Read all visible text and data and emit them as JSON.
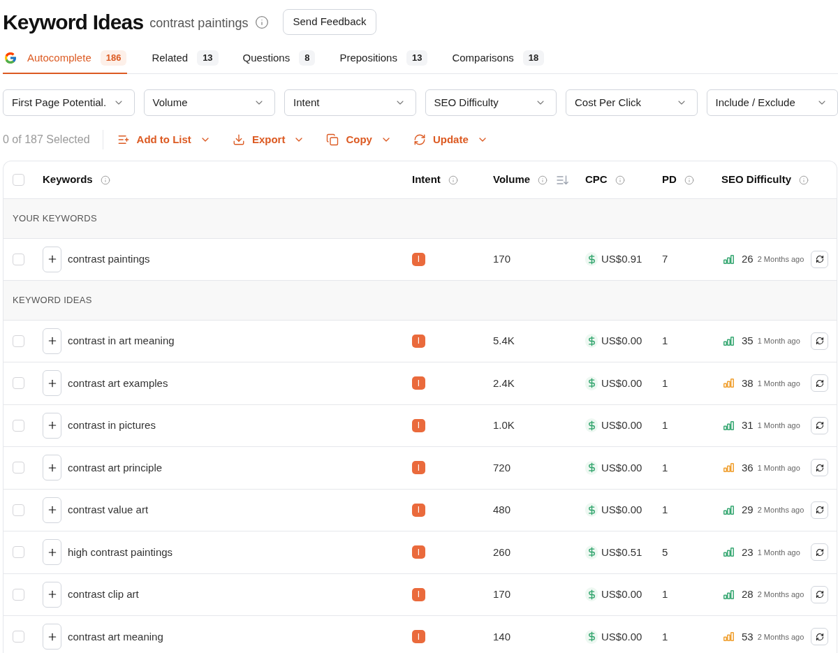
{
  "header": {
    "title": "Keyword Ideas",
    "query": "contrast paintings",
    "feedback_button": "Send Feedback"
  },
  "tabs": [
    {
      "label": "Autocomplete",
      "count": "186",
      "kind": "logo",
      "selected": true
    },
    {
      "label": "Related",
      "count": "13",
      "kind": "plain",
      "selected": false
    },
    {
      "label": "Questions",
      "count": "8",
      "kind": "plain",
      "selected": false
    },
    {
      "label": "Prepositions",
      "count": "13",
      "kind": "plain",
      "selected": false
    },
    {
      "label": "Comparisons",
      "count": "18",
      "kind": "plain",
      "selected": false
    }
  ],
  "filters": [
    "First Page Potential.",
    "Volume",
    "Intent",
    "SEO Difficulty",
    "Cost Per Click",
    "Include / Exclude"
  ],
  "selection": {
    "text": "0 of 187 Selected"
  },
  "actions": [
    {
      "label": "Add to List",
      "kind": "add-list"
    },
    {
      "label": "Export",
      "kind": "export"
    },
    {
      "label": "Copy",
      "kind": "copy"
    },
    {
      "label": "Update",
      "kind": "update"
    }
  ],
  "table": {
    "select_all": {
      "checked": false
    },
    "columns": [
      {
        "label": "Keywords",
        "kind": "info"
      },
      {
        "label": "Intent",
        "kind": "info"
      },
      {
        "label": "Volume",
        "kind": "sortable"
      },
      {
        "label": "CPC",
        "kind": "info"
      },
      {
        "label": "PD",
        "kind": "info"
      },
      {
        "label": "SEO Difficulty",
        "kind": "info"
      }
    ],
    "sections": [
      {
        "title": "YOUR KEYWORDS",
        "rows": [
          {
            "checked": false,
            "keyword": "contrast paintings",
            "intent": "I",
            "volume": "170",
            "cpc": "US$0.91",
            "pd": "7",
            "difficulty": "26",
            "color": "#38a873",
            "updated": "2 Months ago"
          }
        ]
      },
      {
        "title": "KEYWORD IDEAS",
        "rows": [
          {
            "checked": false,
            "keyword": "contrast in art meaning",
            "intent": "I",
            "volume": "5.4K",
            "cpc": "US$0.00",
            "pd": "1",
            "difficulty": "35",
            "color": "#38a873",
            "updated": "1 Month ago"
          },
          {
            "checked": false,
            "keyword": "contrast art examples",
            "intent": "I",
            "volume": "2.4K",
            "cpc": "US$0.00",
            "pd": "1",
            "difficulty": "38",
            "color": "#f0a030",
            "updated": "1 Month ago"
          },
          {
            "checked": false,
            "keyword": "contrast in pictures",
            "intent": "I",
            "volume": "1.0K",
            "cpc": "US$0.00",
            "pd": "1",
            "difficulty": "31",
            "color": "#38a873",
            "updated": "1 Month ago"
          },
          {
            "checked": false,
            "keyword": "contrast art principle",
            "intent": "I",
            "volume": "720",
            "cpc": "US$0.00",
            "pd": "1",
            "difficulty": "36",
            "color": "#f0a030",
            "updated": "1 Month ago"
          },
          {
            "checked": false,
            "keyword": "contrast value art",
            "intent": "I",
            "volume": "480",
            "cpc": "US$0.00",
            "pd": "1",
            "difficulty": "29",
            "color": "#38a873",
            "updated": "2 Months ago"
          },
          {
            "checked": false,
            "keyword": "high contrast paintings",
            "intent": "I",
            "volume": "260",
            "cpc": "US$0.51",
            "pd": "5",
            "difficulty": "23",
            "color": "#38a873",
            "updated": "1 Month ago"
          },
          {
            "checked": false,
            "keyword": "contrast clip art",
            "intent": "I",
            "volume": "170",
            "cpc": "US$0.00",
            "pd": "1",
            "difficulty": "28",
            "color": "#38a873",
            "updated": "2 Months ago"
          },
          {
            "checked": false,
            "keyword": "contrast art meaning",
            "intent": "I",
            "volume": "140",
            "cpc": "US$0.00",
            "pd": "1",
            "difficulty": "53",
            "color": "#f0a030",
            "updated": "2 Months ago"
          }
        ]
      }
    ]
  }
}
